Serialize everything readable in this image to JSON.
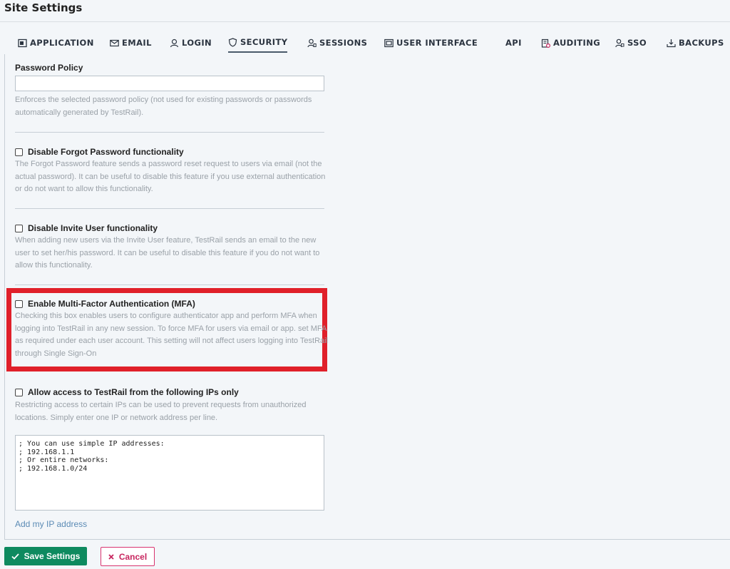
{
  "page": {
    "title": "Site Settings"
  },
  "tabs": [
    {
      "label": "APPLICATION",
      "icon": "application-icon"
    },
    {
      "label": "EMAIL",
      "icon": "email-icon"
    },
    {
      "label": "LOGIN",
      "icon": "login-icon"
    },
    {
      "label": "SECURITY",
      "icon": "shield-icon",
      "active": true
    },
    {
      "label": "SESSIONS",
      "icon": "sessions-icon"
    },
    {
      "label": "USER INTERFACE",
      "icon": "user-interface-icon"
    },
    {
      "label": "API",
      "icon": ""
    },
    {
      "label": "AUDITING",
      "icon": "auditing-icon"
    },
    {
      "label": "SSO",
      "icon": "sso-icon"
    },
    {
      "label": "BACKUPS",
      "icon": "backups-icon"
    }
  ],
  "security": {
    "password_policy": {
      "label": "Password Policy",
      "value": "",
      "help": "Enforces the selected password policy (not used for existing passwords or passwords automatically generated by TestRail)."
    },
    "forgot_password": {
      "label": "Disable Forgot Password functionality",
      "checked": false,
      "help": "The Forgot Password feature sends a password reset request to users via email (not the actual password). It can be useful to disable this feature if you use external authentication or do not want to allow this functionality."
    },
    "invite_user": {
      "label": "Disable Invite User functionality",
      "checked": false,
      "help": "When adding new users via the Invite User feature, TestRail sends an email to the new user to set her/his password. It can be useful to disable this feature if you do not want to allow this functionality."
    },
    "mfa": {
      "label": "Enable Multi-Factor Authentication (MFA)",
      "checked": false,
      "help": "Checking this box enables users to configure authenticator app and perform MFA when logging into TestRail in any new session. To force MFA for users via email or app. set MFA as required under each user account. This setting will not affect users logging into TestRail through Single Sign-On"
    },
    "ip_restriction": {
      "label": "Allow access to TestRail from the following IPs only",
      "checked": false,
      "help": "Restricting access to certain IPs can be used to prevent requests from unauthorized locations. Simply enter one IP or network address per line.",
      "textarea_value": "; You can use simple IP addresses:\n; 192.168.1.1\n; Or entire networks:\n; 192.168.1.0/24",
      "add_ip_link": "Add my IP address"
    }
  },
  "actions": {
    "save_label": "Save Settings",
    "cancel_label": "Cancel"
  },
  "colors": {
    "save": "#0e8a5f",
    "cancel": "#c7255e",
    "highlight": "#e0202a",
    "link": "#5b8bb5"
  }
}
